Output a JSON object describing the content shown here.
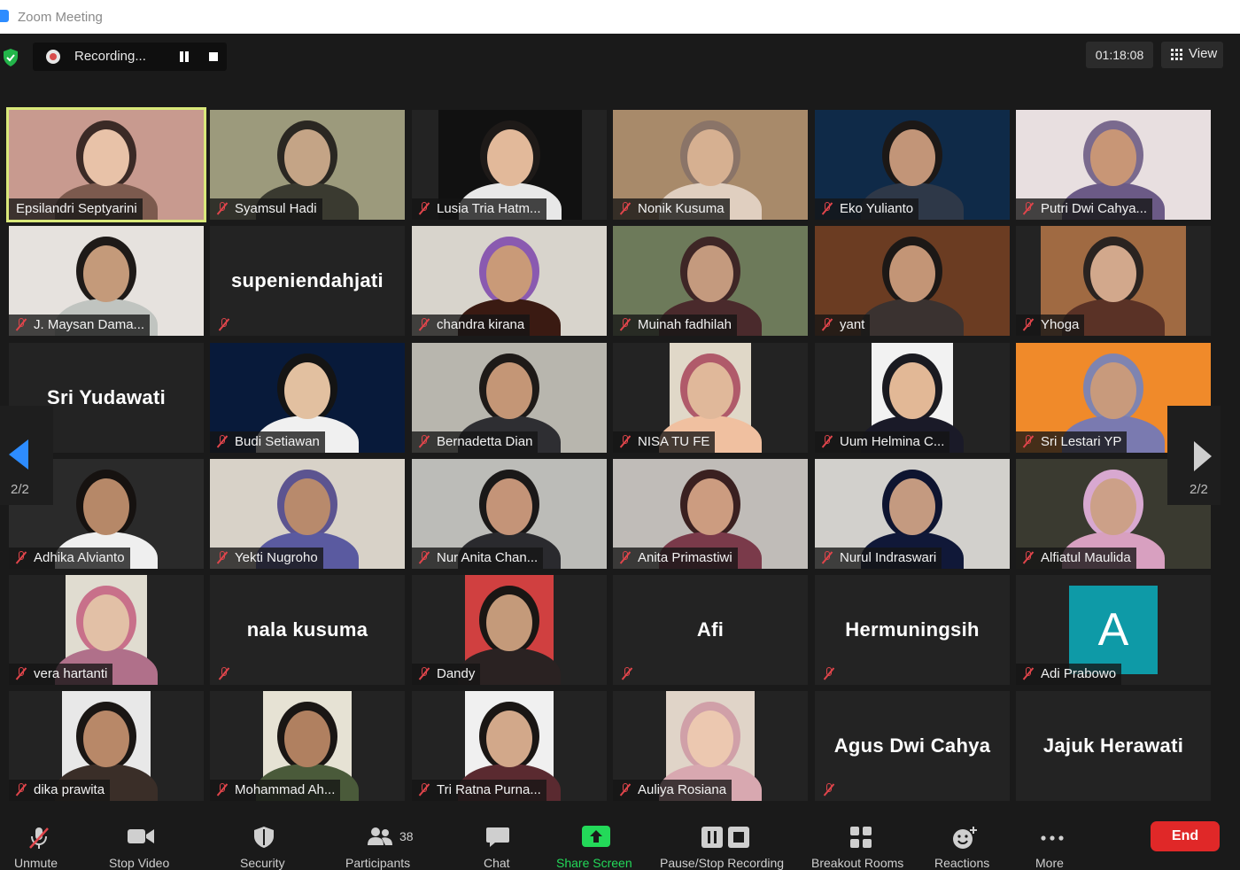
{
  "window": {
    "title": "Zoom Meeting"
  },
  "topbar": {
    "recording_label": "Recording...",
    "timer": "01:18:08",
    "view_label": "View"
  },
  "gallery": {
    "page_left": "2/2",
    "page_right": "2/2",
    "tiles": [
      {
        "name": "Epsilandri Septyarini"
      },
      {
        "name": "Syamsul Hadi"
      },
      {
        "name": "Lusia Tria Hatm..."
      },
      {
        "name": "Nonik Kusuma"
      },
      {
        "name": "Eko Yulianto"
      },
      {
        "name": "Putri Dwi Cahya..."
      },
      {
        "name": "J. Maysan Dama..."
      },
      {
        "display": "supeniendahjati"
      },
      {
        "name": "chandra kirana"
      },
      {
        "name": "Muinah fadhilah"
      },
      {
        "name": "yant"
      },
      {
        "name": "Yhoga"
      },
      {
        "display": "Sri Yudawati"
      },
      {
        "name": "Budi Setiawan"
      },
      {
        "name": "Bernadetta Dian"
      },
      {
        "name": "NISA TU FE"
      },
      {
        "name": "Uum Helmina C..."
      },
      {
        "name": "Sri Lestari YP"
      },
      {
        "name": "Adhika Alvianto"
      },
      {
        "name": "Yekti Nugroho"
      },
      {
        "name": "Nur Anita Chan..."
      },
      {
        "name": "Anita Primastiwi"
      },
      {
        "name": "Nurul Indraswari"
      },
      {
        "name": "Alfiatul Maulida"
      },
      {
        "name": "vera hartanti"
      },
      {
        "display": "nala kusuma"
      },
      {
        "name": "Dandy"
      },
      {
        "display": "Afi"
      },
      {
        "display": "Hermuningsih"
      },
      {
        "name": "Adi Prabowo",
        "avatar_letter": "A"
      },
      {
        "name": "dika prawita"
      },
      {
        "name": "Mohammad Ah..."
      },
      {
        "name": "Tri Ratna Purna..."
      },
      {
        "name": "Auliya Rosiana"
      },
      {
        "display": "Agus Dwi Cahya"
      },
      {
        "display": "Jajuk Herawati"
      }
    ]
  },
  "toolbar": {
    "unmute": "Unmute",
    "stop_video": "Stop Video",
    "security": "Security",
    "participants": "Participants",
    "participants_count": "38",
    "chat": "Chat",
    "share_screen": "Share Screen",
    "pause_stop_recording": "Pause/Stop Recording",
    "breakout_rooms": "Breakout Rooms",
    "reactions": "Reactions",
    "more": "More",
    "end": "End"
  },
  "colors": {
    "accent_blue": "#2d8cff",
    "active_speaker": "#d9e87a",
    "muted_red": "#e0454b",
    "share_green": "#23d959",
    "end_red": "#e02828",
    "avatar_teal": "#0e9aa7"
  }
}
